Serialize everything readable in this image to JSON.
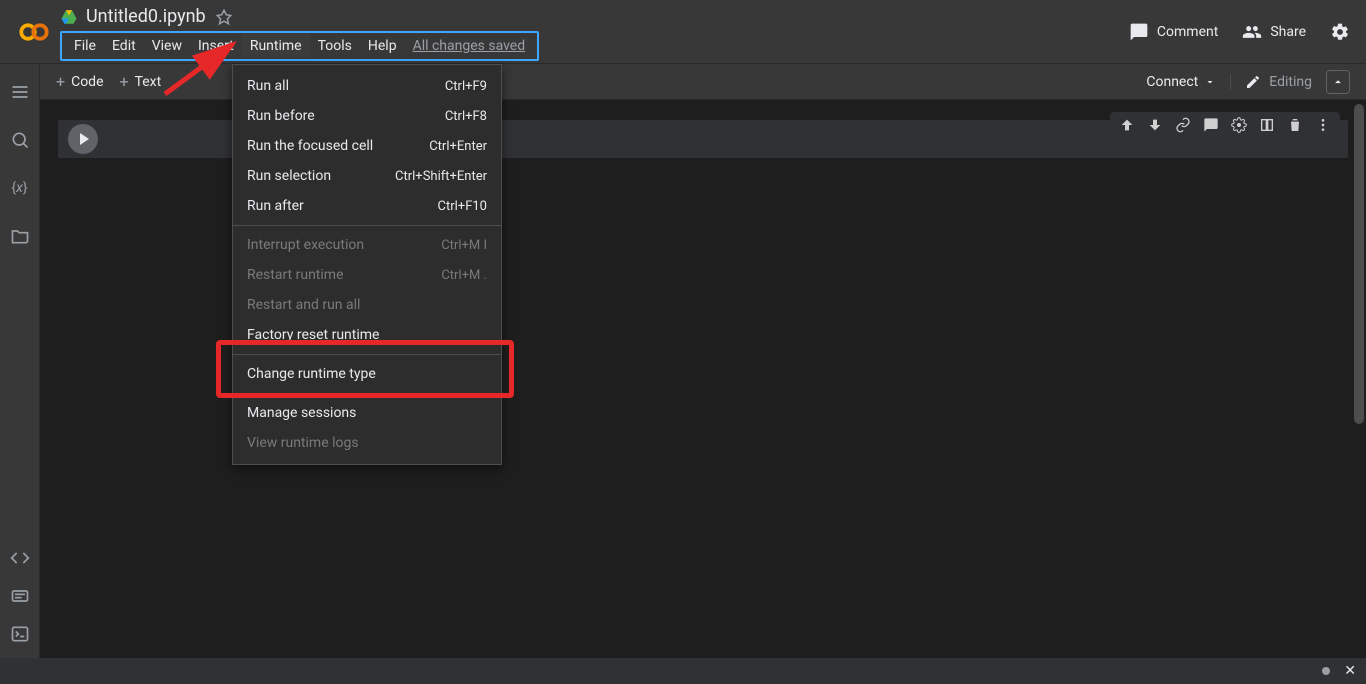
{
  "doc": {
    "title": "Untitled0.ipynb"
  },
  "menu": {
    "file": "File",
    "edit": "Edit",
    "view": "View",
    "insert": "Insert",
    "runtime": "Runtime",
    "tools": "Tools",
    "help": "Help",
    "save_state": "All changes saved"
  },
  "header_actions": {
    "comment": "Comment",
    "share": "Share"
  },
  "toolbar": {
    "code": "Code",
    "text": "Text",
    "connect": "Connect",
    "editing": "Editing"
  },
  "runtime_menu": [
    {
      "label": "Run all",
      "shortcut": "Ctrl+F9",
      "disabled": false
    },
    {
      "label": "Run before",
      "shortcut": "Ctrl+F8",
      "disabled": false
    },
    {
      "label": "Run the focused cell",
      "shortcut": "Ctrl+Enter",
      "disabled": false
    },
    {
      "label": "Run selection",
      "shortcut": "Ctrl+Shift+Enter",
      "disabled": false
    },
    {
      "label": "Run after",
      "shortcut": "Ctrl+F10",
      "disabled": false
    },
    {
      "sep": true
    },
    {
      "label": "Interrupt execution",
      "shortcut": "Ctrl+M I",
      "disabled": true
    },
    {
      "label": "Restart runtime",
      "shortcut": "Ctrl+M .",
      "disabled": true
    },
    {
      "label": "Restart and run all",
      "shortcut": "",
      "disabled": true
    },
    {
      "label": "Factory reset runtime",
      "shortcut": "",
      "disabled": false
    },
    {
      "sep": true
    },
    {
      "label": "Change runtime type",
      "shortcut": "",
      "disabled": false
    },
    {
      "sep": true
    },
    {
      "label": "Manage sessions",
      "shortcut": "",
      "disabled": false
    },
    {
      "label": "View runtime logs",
      "shortcut": "",
      "disabled": true
    }
  ]
}
